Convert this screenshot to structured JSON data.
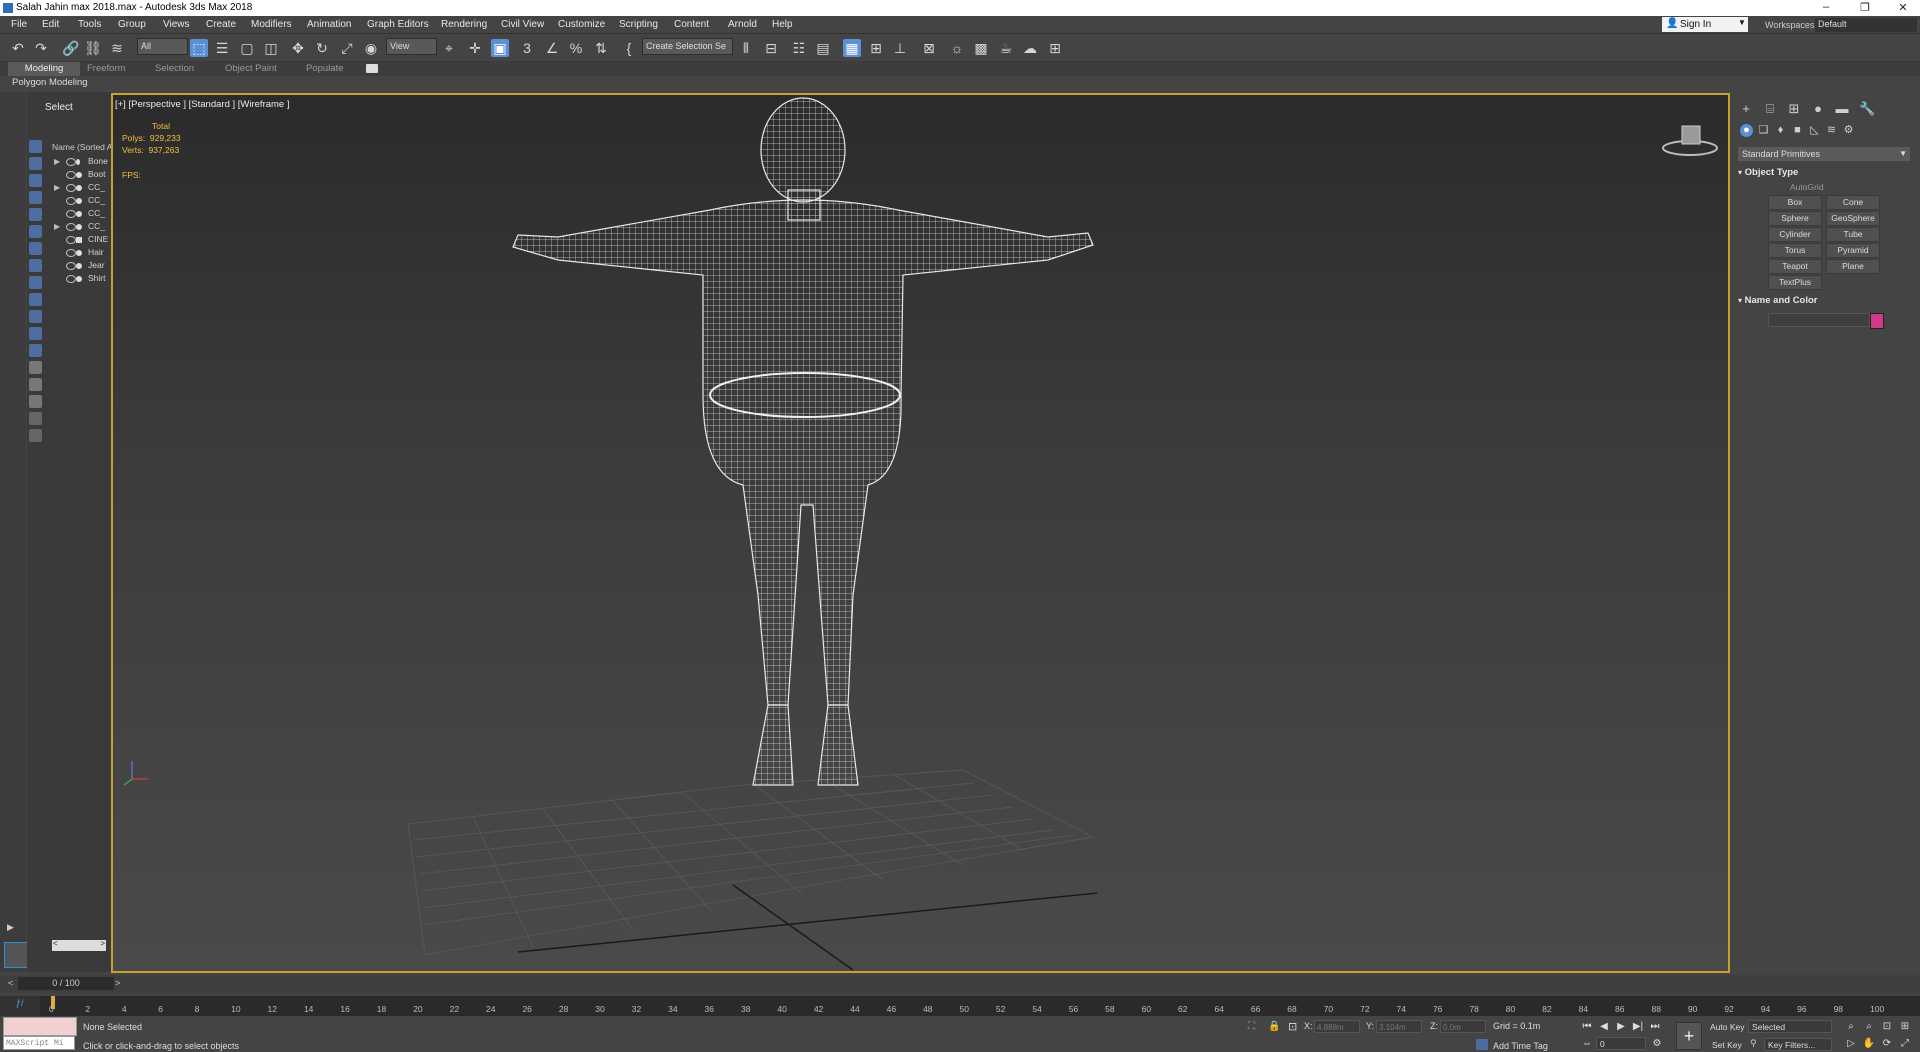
{
  "window": {
    "title": "Salah Jahin max 2018.max - Autodesk 3ds Max 2018",
    "controls": [
      "–",
      "❐",
      "✕"
    ]
  },
  "menu": {
    "items": [
      "File",
      "Edit",
      "Tools",
      "Group",
      "Views",
      "Create",
      "Modifiers",
      "Animation",
      "Graph Editors",
      "Rendering",
      "Civil View",
      "Customize",
      "Scripting",
      "Content",
      "Arnold",
      "Help"
    ],
    "sign_in": "Sign In",
    "workspaces_label": "Workspaces:",
    "workspace_value": "Default"
  },
  "toolbar": {
    "selection_filter": "All",
    "reference_coord": "View",
    "named_selection": "Create Selection Se"
  },
  "ribbon": {
    "tabs": [
      "Modeling",
      "Freeform",
      "Selection",
      "Object Paint",
      "Populate"
    ],
    "active_tab": "Modeling",
    "panel": "Polygon Modeling"
  },
  "explorer": {
    "header": "Select",
    "column": "Name (Sorted A",
    "items": [
      {
        "label": "Bone",
        "expandable": true
      },
      {
        "label": "Boot",
        "expandable": false
      },
      {
        "label": "CC_",
        "expandable": true
      },
      {
        "label": "CC_",
        "expandable": false
      },
      {
        "label": "CC_",
        "expandable": false
      },
      {
        "label": "CC_",
        "expandable": true
      },
      {
        "label": "CINE",
        "expandable": false
      },
      {
        "label": "Hair",
        "expandable": false
      },
      {
        "label": "Jear",
        "expandable": false
      },
      {
        "label": "Shirt",
        "expandable": false
      }
    ]
  },
  "viewport": {
    "label": "[+] [Perspective ] [Standard ] [Wireframe ]",
    "stats": {
      "total_label": "Total",
      "polys_label": "Polys:",
      "polys": "929,233",
      "verts_label": "Verts:",
      "verts": "937,263",
      "fps_label": "FPS:"
    }
  },
  "command_panel": {
    "category": "Standard Primitives",
    "object_type_header": "Object Type",
    "autogrid": "AutoGrid",
    "primitives": [
      "Box",
      "Cone",
      "Sphere",
      "GeoSphere",
      "Cylinder",
      "Tube",
      "Torus",
      "Pyramid",
      "Teapot",
      "Plane",
      "TextPlus"
    ],
    "name_color_header": "Name and Color",
    "object_color": "#d13a8a"
  },
  "timeline": {
    "slider": "0 / 100",
    "ticks": [
      "0",
      "2",
      "4",
      "6",
      "8",
      "10",
      "12",
      "14",
      "16",
      "18",
      "20",
      "22",
      "24",
      "26",
      "28",
      "30",
      "32",
      "34",
      "36",
      "38",
      "40",
      "42",
      "44",
      "46",
      "48",
      "50",
      "52",
      "54",
      "56",
      "58",
      "60",
      "62",
      "64",
      "66",
      "68",
      "70",
      "72",
      "74",
      "76",
      "78",
      "80",
      "82",
      "84",
      "86",
      "88",
      "90",
      "92",
      "94",
      "96",
      "98",
      "100"
    ]
  },
  "status": {
    "maxscript": "MAXScript Mi",
    "selection": "None Selected",
    "prompt": "Click or click-and-drag to select objects",
    "x_label": "X:",
    "x_value": "4.888m",
    "y_label": "Y:",
    "y_value": "3.104m",
    "z_label": "Z:",
    "z_value": "0.0m",
    "grid": "Grid = 0.1m",
    "add_time_tag": "Add Time Tag",
    "auto_key": "Auto Key",
    "selected_value": "Selected",
    "set_key": "Set Key",
    "key_filters": "Key Filters...",
    "frame_value": "0"
  }
}
